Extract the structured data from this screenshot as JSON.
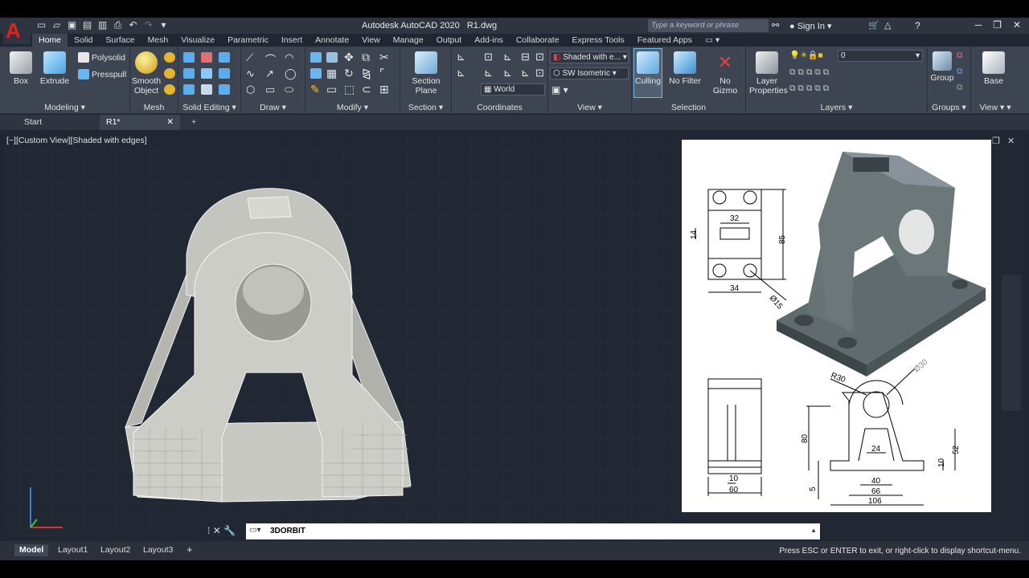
{
  "app": {
    "title": "Autodesk AutoCAD 2020",
    "file": "R1.dwg",
    "logo": "A"
  },
  "search": {
    "placeholder": "Type a keyword or phrase"
  },
  "signin": {
    "label": "Sign In"
  },
  "ribbon_tabs": [
    "Home",
    "Solid",
    "Surface",
    "Mesh",
    "Visualize",
    "Parametric",
    "Insert",
    "Annotate",
    "View",
    "Manage",
    "Output",
    "Add-ins",
    "Collaborate",
    "Express Tools",
    "Featured Apps"
  ],
  "ribbon": {
    "box": "Box",
    "extrude": "Extrude",
    "polysolid": "Polysolid",
    "presspull": "Presspull",
    "smooth_object": "Smooth Object",
    "section_plane": "Section Plane",
    "visual_style": "Shaded with e...",
    "view_preset": "SW Isometric",
    "ucs": "World",
    "culling": "Culling",
    "no_filter": "No Filter",
    "no_gizmo": "No Gizmo",
    "layer_properties": "Layer Properties",
    "layer_value": "0",
    "group": "Group",
    "base": "Base",
    "panels": {
      "modeling": "Modeling",
      "mesh": "Mesh",
      "solid_editing": "Solid Editing",
      "draw": "Draw",
      "modify": "Modify",
      "section": "Section",
      "coordinates": "Coordinates",
      "view": "View",
      "selection": "Selection",
      "layers": "Layers",
      "groups": "Groups",
      "view2": "View"
    }
  },
  "file_tabs": {
    "start": "Start",
    "r1": "R1*"
  },
  "viewport": {
    "label": "[−][Custom View][Shaded with edges]"
  },
  "drawing_dims": {
    "d32": "32",
    "d14": "14",
    "d85": "85",
    "d34": "34",
    "d15": "Ø15",
    "r30": "R30",
    "d30": "Ø30",
    "d80": "80",
    "d24": "24",
    "d52": "52",
    "d10a": "10",
    "d10b": "10",
    "d5": "5",
    "d40": "40",
    "d66": "66",
    "d106": "106",
    "d60": "60"
  },
  "command": {
    "value": "3DORBIT"
  },
  "layouts": [
    "Model",
    "Layout1",
    "Layout2",
    "Layout3"
  ],
  "status": {
    "message": "Press ESC or ENTER to exit, or right-click to display shortcut-menu."
  },
  "colors": {
    "accent": "#e0221e",
    "background": "#222833",
    "ribbon": "#3d4552"
  }
}
